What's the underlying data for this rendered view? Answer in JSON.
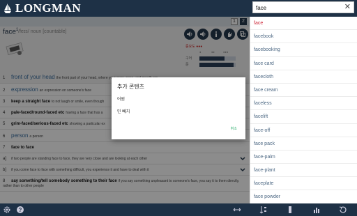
{
  "app": {
    "logo_text": "LONGMAN"
  },
  "search": {
    "value": "face",
    "clear_icon": "close-icon"
  },
  "pagination": {
    "pages": [
      "1",
      "2"
    ],
    "active": "2"
  },
  "entry": {
    "headword": "face",
    "homograph": "1",
    "pronunciation": "/feɪs/",
    "pos": "noun",
    "grammar": "[countable]",
    "frequency_label": "중요도 ●●●",
    "freq_rows": [
      {
        "name": "구어",
        "level": 0.7
      },
      {
        "name": "문",
        "level": 0.95
      }
    ],
    "freq_headers": [
      "●",
      "●●",
      "●●●"
    ],
    "toolbar_icons": [
      "speaker-uk-icon",
      "speaker-us-icon",
      "info-icon",
      "hand-icon",
      "copy-icon"
    ]
  },
  "senses": [
    {
      "num": "1",
      "signpost": "front of your head",
      "style": "blue",
      "definition": "the front part of your head, where your eyes, nose, and mouth are"
    },
    {
      "num": "2",
      "signpost": "expression",
      "style": "blue",
      "definition": "an expression on someone's face"
    },
    {
      "num": "3",
      "signpost": "keep a straight face",
      "style": "bold",
      "definition": "to not laugh or smile, even though"
    },
    {
      "num": "4",
      "signpost": "pale-faced/round-faced etc",
      "style": "bold",
      "definition": "having a face that has a"
    },
    {
      "num": "5",
      "signpost": "grim-faced/serious-faced etc",
      "style": "bold",
      "definition": "showing a particular ex"
    },
    {
      "num": "6",
      "signpost": "person",
      "style": "blue",
      "definition": "a person"
    },
    {
      "num": "7",
      "signpost": "face to face",
      "style": "bold",
      "definition": ""
    },
    {
      "num": "a]",
      "signpost": "",
      "style": "plain",
      "definition": "if two people are standing face to face, they are very close and are looking at each other"
    },
    {
      "num": "b]",
      "signpost": "",
      "style": "plain",
      "definition": "if you come face to face with something difficult, you experience it and have to deal with it"
    },
    {
      "num": "8",
      "signpost": "say something/tell somebody something to their face",
      "style": "bold",
      "definition": "if you say something unpleasant to someone's face, you say it to them directly, rather than to other people"
    }
  ],
  "results": [
    "face",
    "facebook",
    "facebooking",
    "face card",
    "facecloth",
    "face cream",
    "faceless",
    "facelift",
    "face-off",
    "face pack",
    "face-palm",
    "face-plant",
    "faceplate",
    "face powder"
  ],
  "dialog": {
    "title": "추가 콘텐츠",
    "options": [
      "어원",
      "민 뻬치"
    ],
    "cancel": "취소"
  },
  "bottom_icons": [
    "gear-icon",
    "help-icon",
    "resize-icon",
    "sort-az-icon",
    "bookmark-icon",
    "stats-icon",
    "history-icon"
  ],
  "colors": {
    "navy": "#1e3146",
    "accent_red": "#c22",
    "link_blue": "#4f6a85",
    "dialog_cancel": "#2a6"
  }
}
